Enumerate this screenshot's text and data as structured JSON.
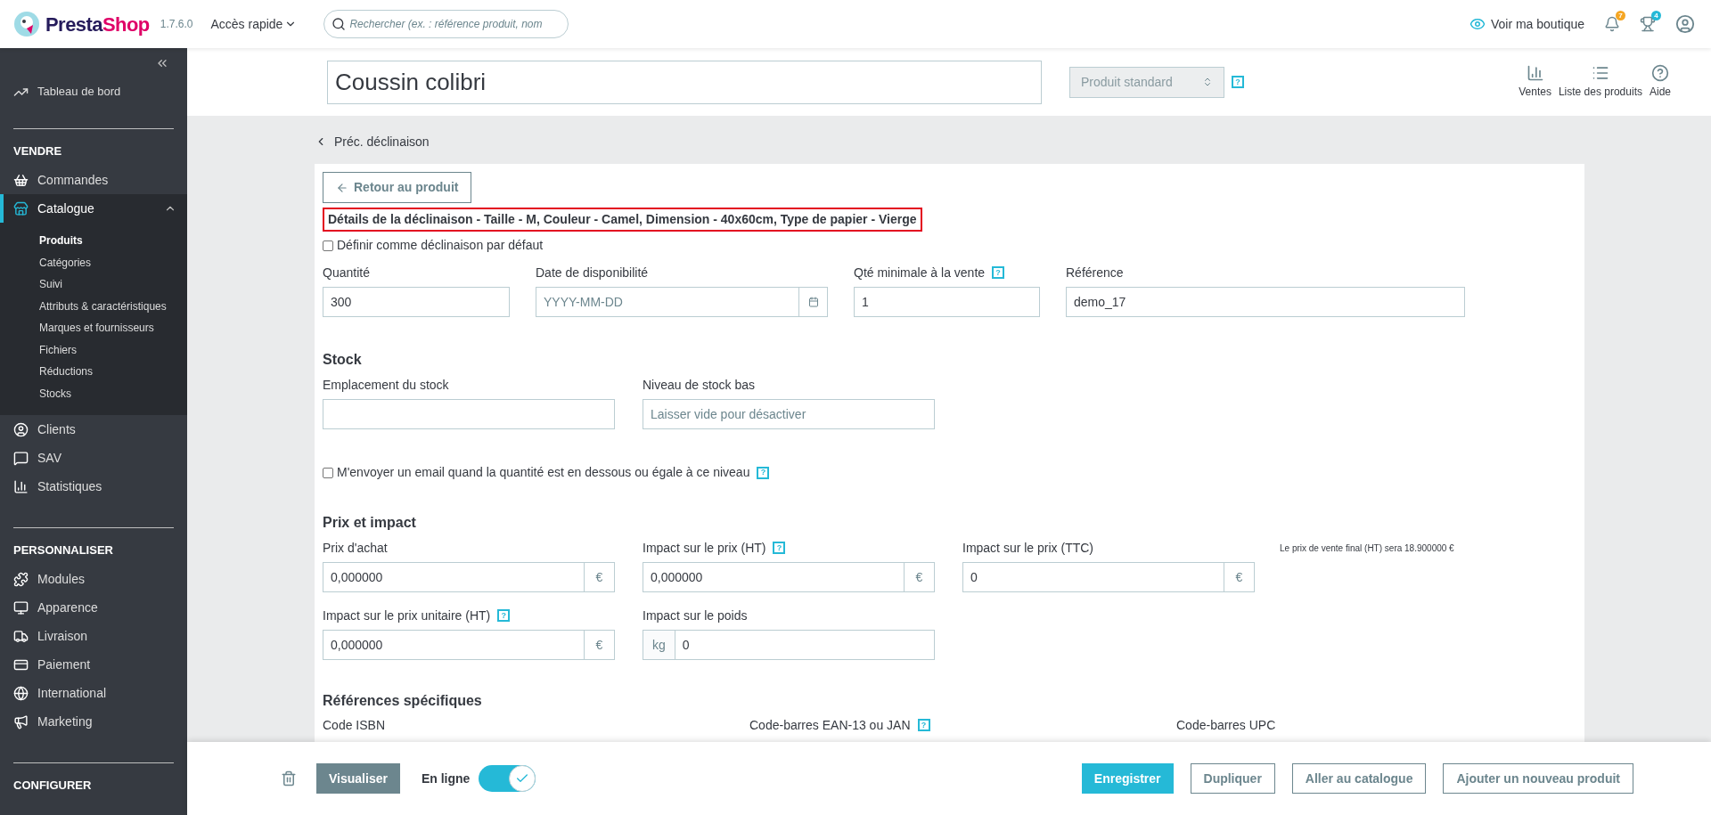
{
  "topbar": {
    "logo_parts": [
      "Presta",
      "Shop"
    ],
    "version": "1.7.6.0",
    "quick_access": "Accès rapide",
    "search": {
      "placeholder": "Rechercher (ex. : référence produit, nom"
    },
    "view_shop": "Voir ma boutique",
    "badges": [
      {
        "count": "7",
        "color": "#f5a623"
      },
      {
        "count": "4",
        "color": "#25b9d7"
      }
    ]
  },
  "sidebar": {
    "top_items": [
      {
        "label": "Tableau de bord",
        "selected": false
      }
    ],
    "sections": [
      {
        "title": "VENDRE",
        "items": [
          {
            "label": "Commandes",
            "selected": false
          },
          {
            "label": "Catalogue",
            "selected": true,
            "expanded": true,
            "children": [
              {
                "label": "Produits",
                "selected": true
              },
              {
                "label": "Catégories",
                "selected": false
              },
              {
                "label": "Suivi",
                "selected": false
              },
              {
                "label": "Attributs & caractéristiques",
                "selected": false
              },
              {
                "label": "Marques et fournisseurs",
                "selected": false
              },
              {
                "label": "Fichiers",
                "selected": false
              },
              {
                "label": "Réductions",
                "selected": false
              },
              {
                "label": "Stocks",
                "selected": false
              }
            ]
          },
          {
            "label": "Clients",
            "selected": false
          },
          {
            "label": "SAV",
            "selected": false
          },
          {
            "label": "Statistiques",
            "selected": false
          }
        ]
      },
      {
        "title": "PERSONNALISER",
        "items": [
          {
            "label": "Modules",
            "selected": false
          },
          {
            "label": "Apparence",
            "selected": false
          },
          {
            "label": "Livraison",
            "selected": false
          },
          {
            "label": "Paiement",
            "selected": false
          },
          {
            "label": "International",
            "selected": false
          },
          {
            "label": "Marketing",
            "selected": false
          }
        ]
      },
      {
        "title": "CONFIGURER"
      }
    ]
  },
  "product_header": {
    "name": "Coussin colibri",
    "type_select": "Produit standard",
    "help": "?",
    "actions": [
      {
        "label": "Ventes"
      },
      {
        "label": "Liste des produits"
      },
      {
        "label": "Aide"
      }
    ]
  },
  "back_link": "Préc. déclinaison",
  "form": {
    "back_button": "Retour au produit",
    "title": "Détails de la déclinaison - Taille - M, Couleur - Camel, Dimension - 40x60cm, Type de papier - Vierge",
    "title_highlighted": true,
    "default_checkbox": {
      "label": "Définir comme déclinaison par défaut",
      "checked": false
    },
    "main_fields": [
      {
        "label": "Quantité",
        "value": "300"
      },
      {
        "label": "Date de disponibilité",
        "placeholder": "YYYY-MM-DD",
        "kind": "date"
      },
      {
        "label": "Qté minimale à la vente",
        "help": "?",
        "value": "1"
      },
      {
        "label": "Référence",
        "value": "demo_17"
      }
    ],
    "stock": {
      "title": "Stock",
      "fields": [
        {
          "label": "Emplacement du stock"
        },
        {
          "label": "Niveau de stock bas",
          "placeholder": "Laisser vide pour désactiver"
        }
      ]
    },
    "email_checkbox": {
      "label": "M'envoyer un email quand la quantité est en dessous ou égale à ce niveau",
      "checked": false,
      "help": "?"
    },
    "pricing": {
      "title": "Prix et impact",
      "note": "Le prix de vente final (HT) sera 18.900000 €",
      "fields": [
        {
          "label": "Prix d'achat",
          "value": "0,000000",
          "suffix": "€"
        },
        {
          "label": "Impact sur le prix (HT)",
          "help": "?",
          "value": "0,000000",
          "suffix": "€"
        },
        {
          "label": "Impact sur le prix (TTC)",
          "value": "0",
          "suffix": "€"
        }
      ],
      "fields_2": [
        {
          "label": "Impact sur le prix unitaire (HT)",
          "help": "?",
          "value": "0,000000",
          "suffix": "€"
        },
        {
          "label": "Impact sur le poids",
          "prefix": "kg",
          "value": "0"
        }
      ]
    },
    "references": {
      "title": "Références spécifiques",
      "fields": [
        {
          "label": "Code ISBN"
        },
        {
          "label": "Code-barres EAN-13 ou JAN",
          "help": "?"
        },
        {
          "label": "Code-barres UPC"
        }
      ]
    }
  },
  "footer": {
    "preview": "Visualiser",
    "online": {
      "label": "En ligne",
      "on": true
    },
    "buttons": [
      {
        "label": "Enregistrer",
        "kind": "primary"
      },
      {
        "label": "Dupliquer",
        "kind": "outline"
      },
      {
        "label": "Aller au catalogue",
        "kind": "outline"
      },
      {
        "label": "Ajouter un nouveau produit",
        "kind": "outline"
      }
    ]
  }
}
